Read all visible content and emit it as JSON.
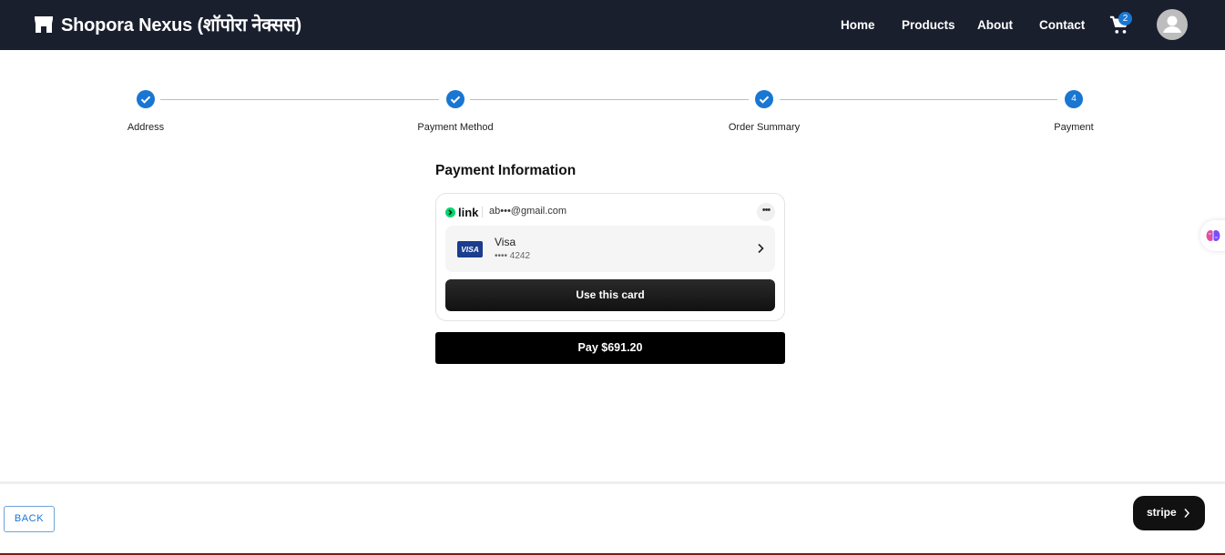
{
  "header": {
    "brand": "Shopora Nexus (शॉपोरा नेक्सस)",
    "nav": [
      "Home",
      "Products",
      "About",
      "Contact"
    ],
    "cart_count": "2"
  },
  "stepper": {
    "steps": [
      {
        "label": "Address",
        "state": "completed"
      },
      {
        "label": "Payment Method",
        "state": "completed"
      },
      {
        "label": "Order Summary",
        "state": "completed"
      },
      {
        "label": "Payment",
        "state": "active",
        "number": "4"
      }
    ]
  },
  "payment": {
    "title": "Payment Information",
    "link_brand": "link",
    "email": "ab•••@gmail.com",
    "card_brand_badge": "VISA",
    "card_name": "Visa",
    "card_number": "•••• 4242",
    "use_card_label": "Use this card",
    "pay_label": "Pay $691.20"
  },
  "footer": {
    "back_label": "BACK",
    "stripe_label": "stripe"
  },
  "colors": {
    "header_bg": "#1a1f2e",
    "accent": "#1976d2",
    "link_green": "#00d66f",
    "visa_blue": "#1a3d8f"
  }
}
